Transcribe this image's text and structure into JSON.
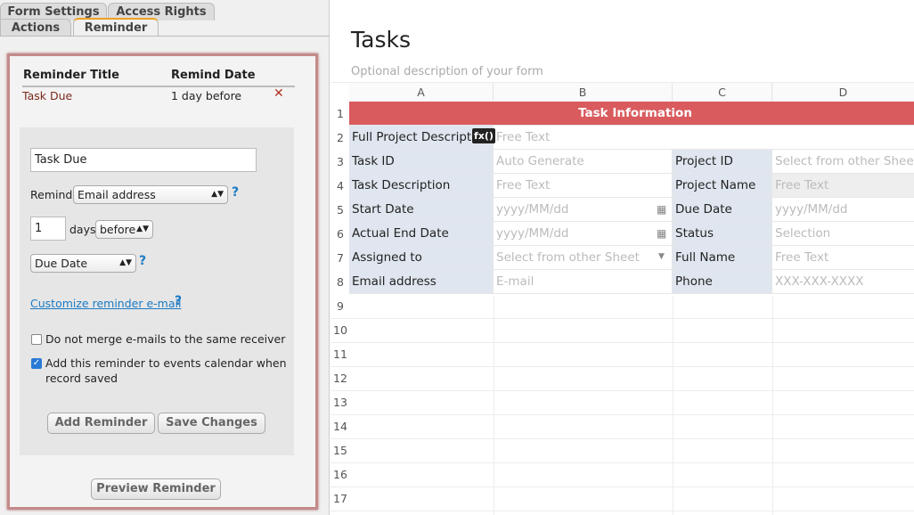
{
  "tabs": {
    "form_settings": "Form Settings",
    "access_rights": "Access Rights",
    "actions": "Actions",
    "reminder": "Reminder"
  },
  "reminder_table": {
    "headers": [
      "Reminder Title",
      "Remind Date"
    ],
    "rows": [
      {
        "title": "Task Due",
        "date": "1 day before"
      }
    ]
  },
  "form": {
    "title_value": "Task Due",
    "remind_label": "Remind",
    "remind_select": "Email address",
    "days_value": "1",
    "days_label": "days",
    "before_select": "before",
    "field_select": "Due Date",
    "customize_link": "Customize reminder e-mail",
    "no_merge_label": "Do not merge e-mails to the same receiver",
    "no_merge_checked": false,
    "add_calendar_label": "Add this reminder to events calendar when record saved",
    "add_calendar_checked": true,
    "add_button": "Add Reminder",
    "save_button": "Save Changes"
  },
  "preview_button": "Preview Reminder",
  "sheet": {
    "title": "Tasks",
    "description": "Optional description of your form",
    "columns": [
      "A",
      "B",
      "C",
      "D"
    ],
    "rows": [
      "1",
      "2",
      "3",
      "4",
      "5",
      "6",
      "7",
      "8",
      "9",
      "10",
      "11",
      "12",
      "13",
      "14",
      "15",
      "16",
      "17"
    ],
    "header": "Task Information",
    "header_color": "#d95b5e",
    "fx_badge": "fx()",
    "cells": [
      [
        "Full Project Description",
        "Free Text"
      ],
      [
        "Task ID",
        "Auto Generate",
        "Project ID",
        "Select from other Sheet"
      ],
      [
        "Task Description",
        "Free Text",
        "Project Name",
        "Free Text"
      ],
      [
        "Start Date",
        "yyyy/MM/dd",
        "Due Date",
        "yyyy/MM/dd"
      ],
      [
        "Actual End Date",
        "yyyy/MM/dd",
        "Status",
        "Selection"
      ],
      [
        "Assigned to",
        "Select from other Sheet",
        "Full Name",
        "Free Text"
      ],
      [
        "Email address",
        "E-mail",
        "Phone",
        "XXX-XXX-XXXX"
      ]
    ]
  }
}
